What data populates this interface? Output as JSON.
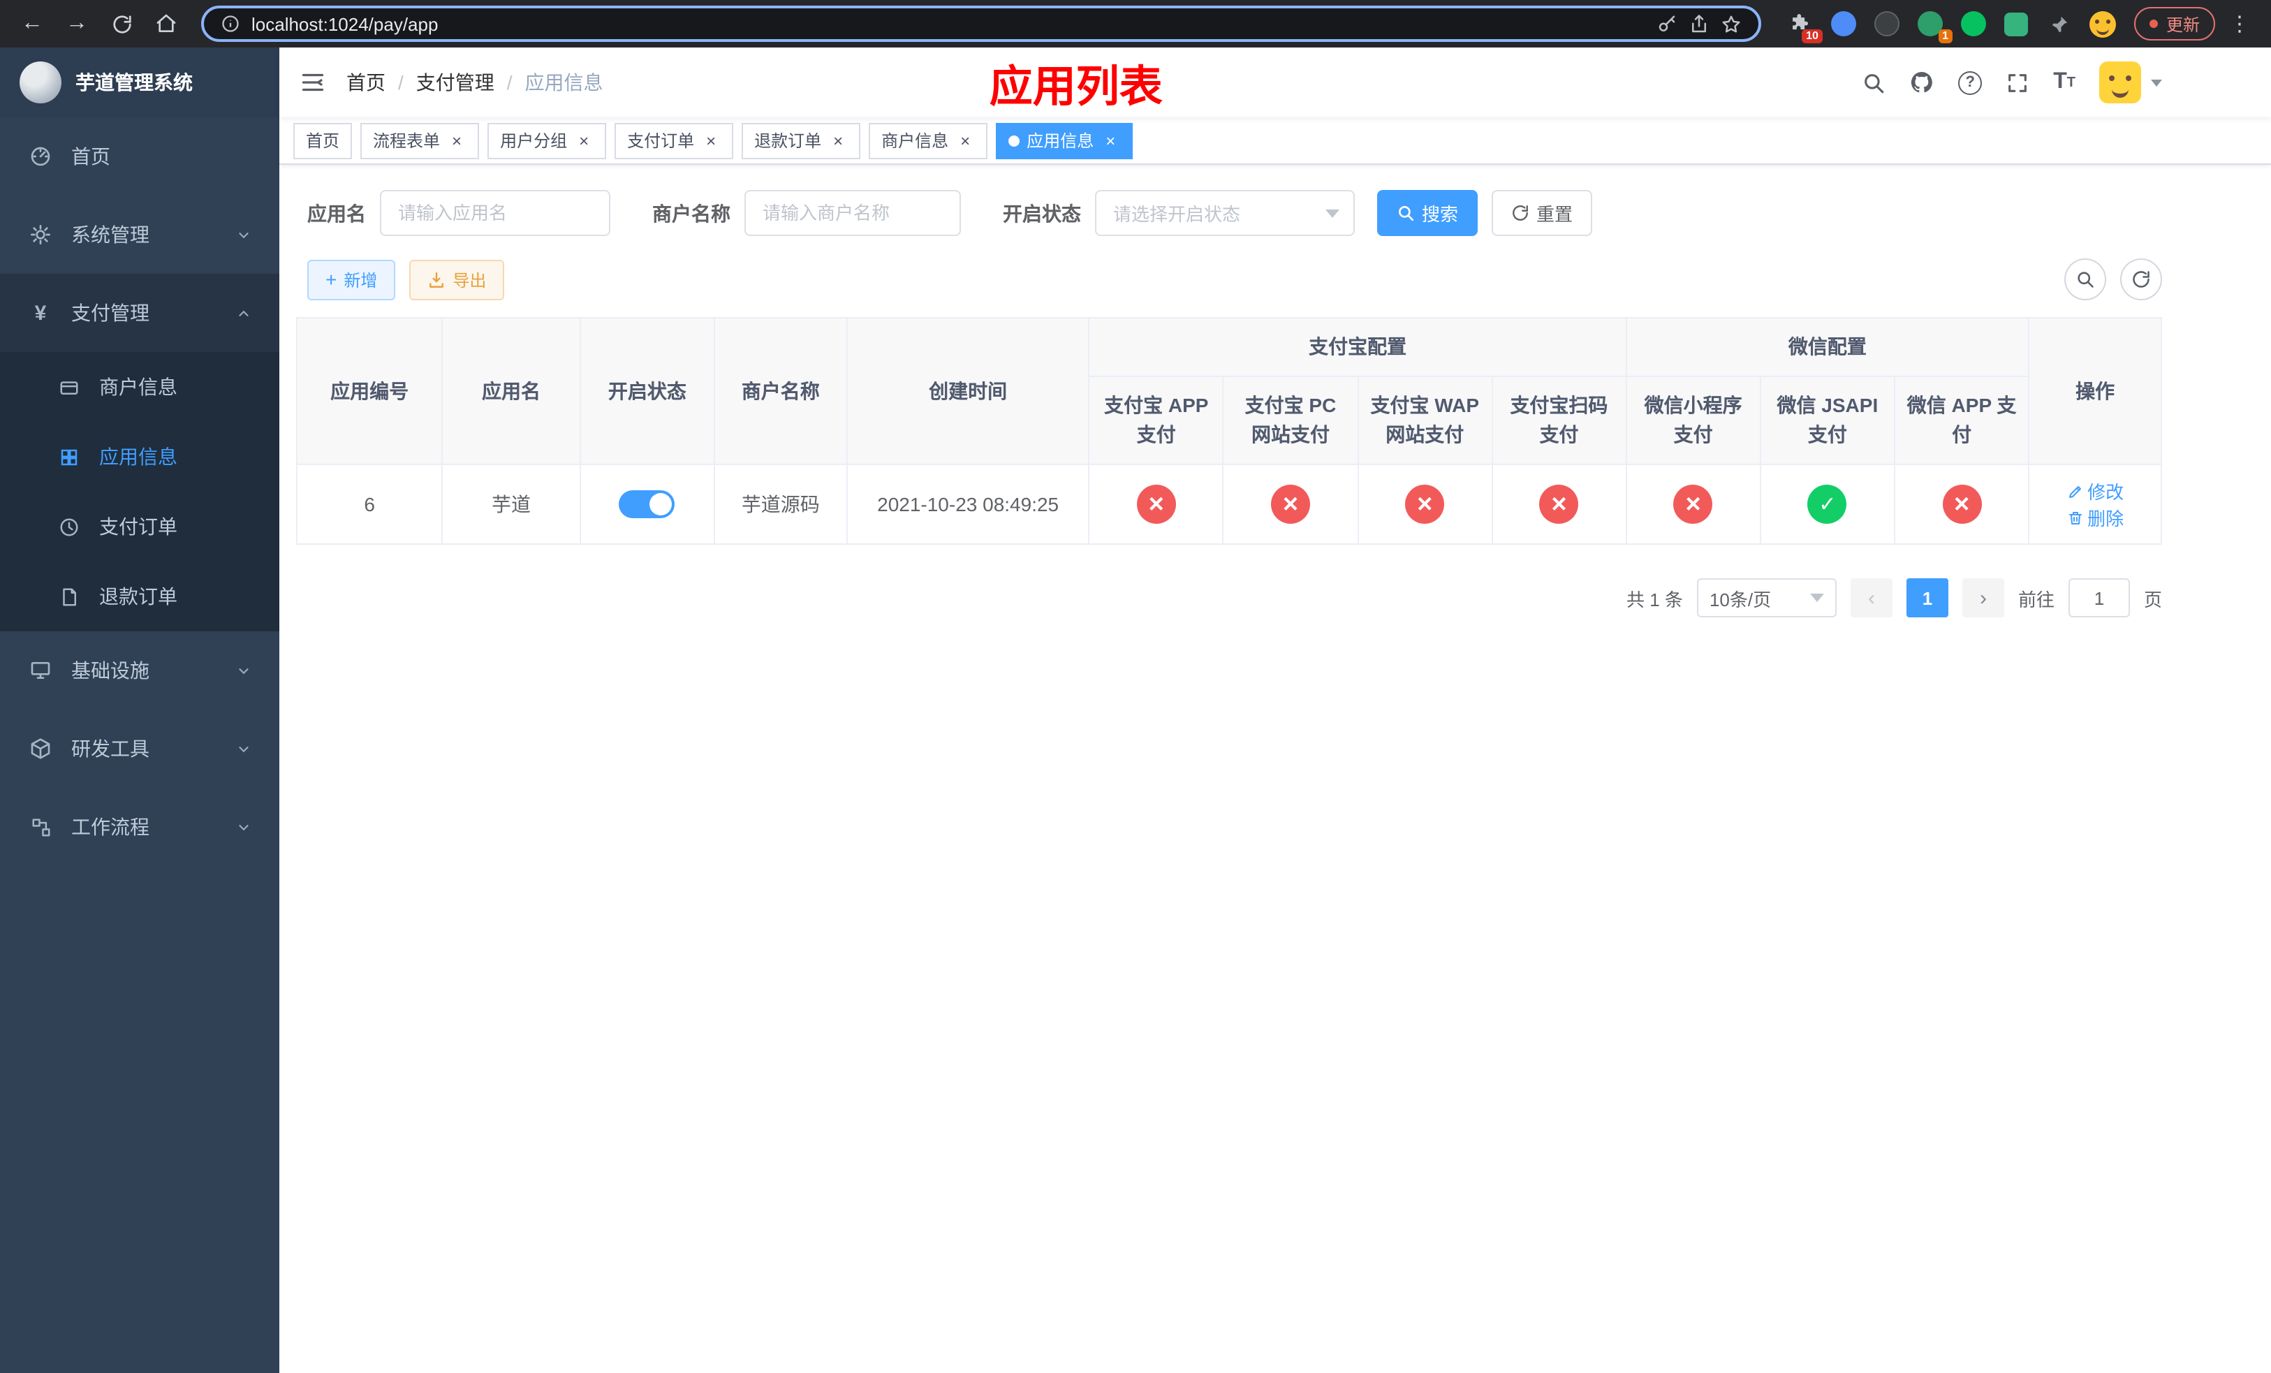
{
  "browser": {
    "url": "localhost:1024/pay/app",
    "update_label": "更新",
    "extensions_badge": "10",
    "ext_badge_1": "1"
  },
  "sidebar": {
    "title": "芋道管理系统",
    "items": {
      "home": "首页",
      "system": "系统管理",
      "pay": "支付管理",
      "merchant": "商户信息",
      "app_info": "应用信息",
      "pay_order": "支付订单",
      "refund_order": "退款订单",
      "infra": "基础设施",
      "devtool": "研发工具",
      "workflow": "工作流程"
    }
  },
  "topbar": {
    "breadcrumb_home": "首页",
    "breadcrumb_pay": "支付管理",
    "breadcrumb_current": "应用信息",
    "page_title": "应用列表"
  },
  "tabs": [
    {
      "label": "首页"
    },
    {
      "label": "流程表单"
    },
    {
      "label": "用户分组"
    },
    {
      "label": "支付订单"
    },
    {
      "label": "退款订单"
    },
    {
      "label": "商户信息"
    },
    {
      "label": "应用信息"
    }
  ],
  "filters": {
    "app_name_label": "应用名",
    "app_name_placeholder": "请输入应用名",
    "merchant_label": "商户名称",
    "merchant_placeholder": "请输入商户名称",
    "status_label": "开启状态",
    "status_placeholder": "请选择开启状态",
    "search_label": "搜索",
    "reset_label": "重置"
  },
  "toolbar": {
    "add_label": "新增",
    "export_label": "导出"
  },
  "table": {
    "headers": {
      "app_id": "应用编号",
      "app_name": "应用名",
      "status": "开启状态",
      "merchant_name": "商户名称",
      "create_time": "创建时间",
      "alipay_group": "支付宝配置",
      "wechat_group": "微信配置",
      "alipay_app": "支付宝 APP 支付",
      "alipay_pc": "支付宝 PC 网站支付",
      "alipay_wap": "支付宝 WAP 网站支付",
      "alipay_qr": "支付宝扫码支付",
      "wx_lite": "微信小程序支付",
      "wx_jsapi": "微信 JSAPI 支付",
      "wx_app": "微信 APP 支付",
      "actions": "操作"
    },
    "row": {
      "app_id": "6",
      "app_name": "芋道",
      "status_on": true,
      "merchant_name": "芋道源码",
      "create_time": "2021-10-23 08:49:25",
      "config": {
        "alipay_app": false,
        "alipay_pc": false,
        "alipay_wap": false,
        "alipay_qr": false,
        "wx_lite": false,
        "wx_jsapi": true,
        "wx_app": false
      },
      "edit_label": "修改",
      "delete_label": "删除"
    }
  },
  "pagination": {
    "total_text": "共 1 条",
    "page_size": "10条/页",
    "current_page": "1",
    "goto_label": "前往",
    "goto_value": "1",
    "goto_suffix": "页"
  },
  "colors": {
    "primary": "#409eff",
    "success": "#13ce66",
    "danger": "#f25a5a",
    "sidebar_bg": "#304156",
    "submenu_bg": "#1f2d3d",
    "title_red": "#ff0000"
  }
}
